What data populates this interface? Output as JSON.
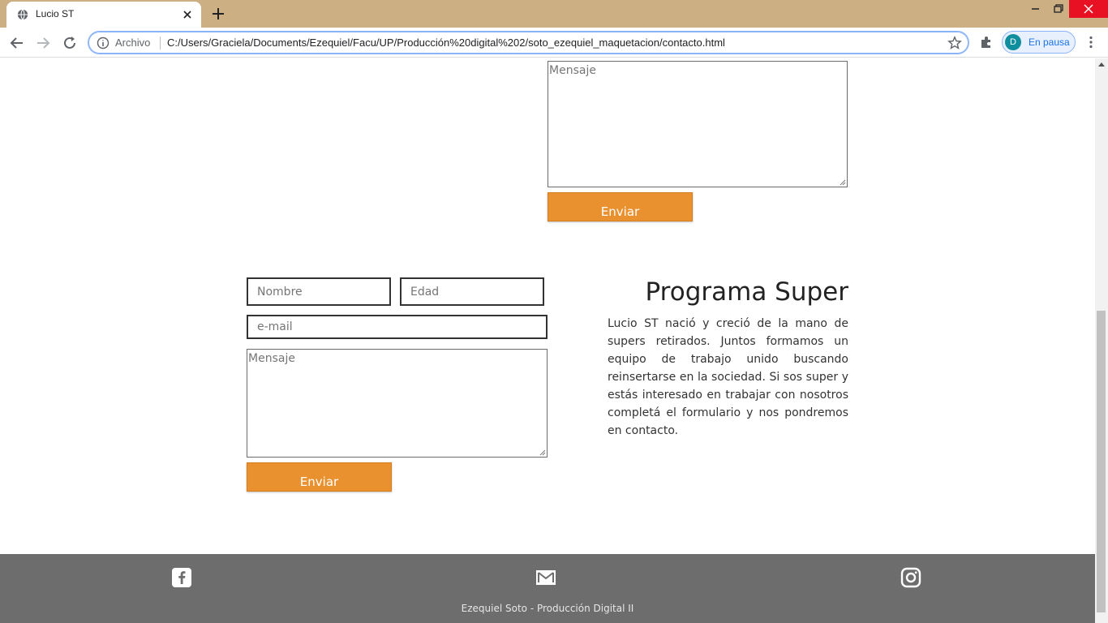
{
  "browser": {
    "tab_title": "Lucio ST",
    "scheme_label": "Archivo",
    "url": "C:/Users/Graciela/Documents/Ezequiel/Facu/UP/Producción%20digital%202/soto_ezequiel_maquetacion/contacto.html",
    "profile_initial": "D",
    "profile_status": "En pausa",
    "accent_color": "#1a73e8",
    "tabbar_color": "#ccb084"
  },
  "form_top": {
    "message_placeholder": "Mensaje",
    "submit_label": "Enviar"
  },
  "form_bottom": {
    "name_placeholder": "Nombre",
    "age_placeholder": "Edad",
    "email_placeholder": "e-mail",
    "message_placeholder": "Mensaje",
    "submit_label": "Enviar"
  },
  "program": {
    "title": "Programa Super",
    "description": "Lucio ST nació y creció de la mano de supers retirados. Juntos formamos un equipo de trabajo unido buscando reinsertarse en la sociedad. Si sos super y estás interesado en trabajar con nosotros completá el formulario y nos pondremos en contacto."
  },
  "footer": {
    "icons": [
      "facebook-icon",
      "mail-icon",
      "instagram-icon"
    ],
    "credit": "Ezequiel Soto - Producción Digital II"
  },
  "colors": {
    "button": "#e8912e",
    "footer": "#6d6d6d"
  }
}
